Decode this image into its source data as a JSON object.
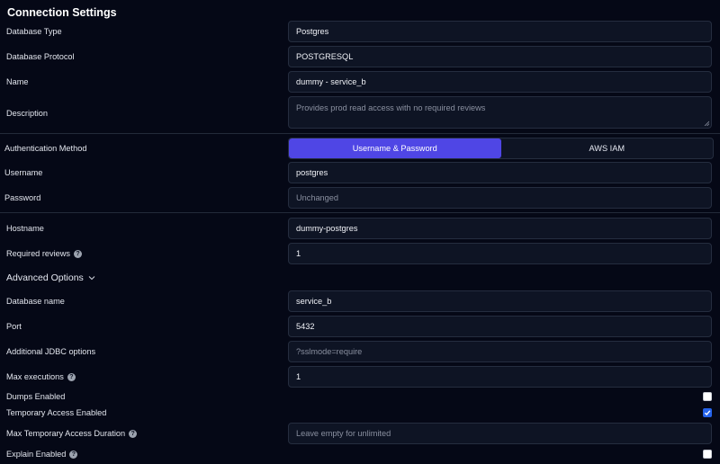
{
  "title": "Connection Settings",
  "fields": {
    "database_type": {
      "label": "Database Type",
      "value": "Postgres"
    },
    "database_protocol": {
      "label": "Database Protocol",
      "value": "POSTGRESQL"
    },
    "name": {
      "label": "Name",
      "value": "dummy - service_b"
    },
    "description": {
      "label": "Description",
      "value": "Provides prod read access with no required reviews"
    },
    "auth_method": {
      "label": "Authentication Method",
      "options": [
        "Username & Password",
        "AWS IAM"
      ],
      "selected": "Username & Password"
    },
    "username": {
      "label": "Username",
      "value": "postgres"
    },
    "password": {
      "label": "Password",
      "placeholder": "Unchanged"
    },
    "hostname": {
      "label": "Hostname",
      "value": "dummy-postgres"
    },
    "required_reviews": {
      "label": "Required reviews",
      "value": "1"
    },
    "advanced_options": {
      "label": "Advanced Options"
    },
    "database_name": {
      "label": "Database name",
      "value": "service_b"
    },
    "port": {
      "label": "Port",
      "value": "5432"
    },
    "jdbc_options": {
      "label": "Additional JDBC options",
      "placeholder": "?sslmode=require"
    },
    "max_executions": {
      "label": "Max executions",
      "value": "1"
    },
    "dumps_enabled": {
      "label": "Dumps Enabled",
      "checked": false
    },
    "temp_access_enabled": {
      "label": "Temporary Access Enabled",
      "checked": true
    },
    "max_temp_access_duration": {
      "label": "Max Temporary Access Duration",
      "placeholder": "Leave empty for unlimited"
    },
    "explain_enabled": {
      "label": "Explain Enabled",
      "checked": false
    }
  },
  "colors": {
    "background": "#050816",
    "accent": "#4f46e5",
    "checkbox_checked": "#2563eb"
  },
  "icons": [
    "help-icon",
    "chevron-down-icon",
    "checkmark-icon",
    "resize-handle-icon"
  ]
}
